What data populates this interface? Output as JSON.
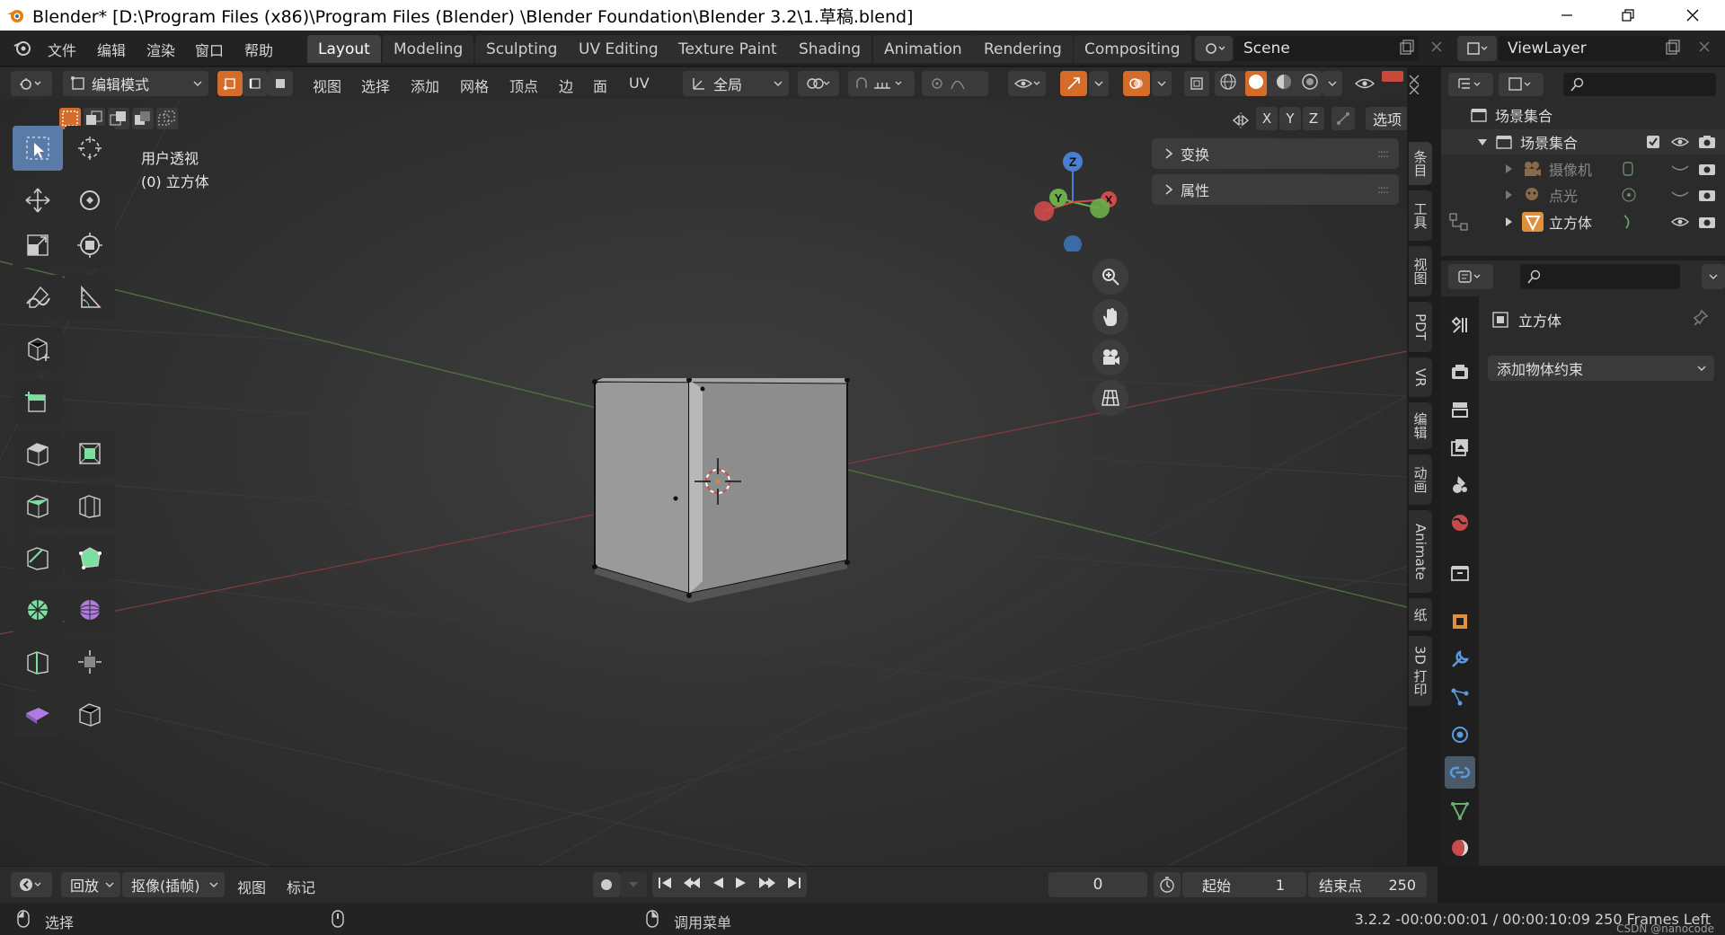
{
  "titlebar": {
    "title": "Blender* [D:\\Program Files (x86)\\Program Files  (Blender)  \\Blender Foundation\\Blender 3.2\\1.草稿.blend]"
  },
  "menu": {
    "file": "文件",
    "edit": "编辑",
    "render": "渲染",
    "window": "窗口",
    "help": "帮助"
  },
  "workspaces": [
    {
      "label": "Layout",
      "active": true
    },
    {
      "label": "Modeling"
    },
    {
      "label": "Sculpting"
    },
    {
      "label": "UV Editing"
    },
    {
      "label": "Texture Paint"
    },
    {
      "label": "Shading"
    },
    {
      "label": "Animation"
    },
    {
      "label": "Rendering"
    },
    {
      "label": "Compositing"
    }
  ],
  "scene": {
    "name": "Scene",
    "view_layer": "ViewLayer"
  },
  "header": {
    "mode": "编辑模式",
    "view": "视图",
    "select": "选择",
    "add": "添加",
    "mesh": "网格",
    "vertex": "顶点",
    "edge": "边",
    "face": "面",
    "uv": "UV",
    "orientation": "全局",
    "options": "选项",
    "axis_x": "X",
    "axis_y": "Y",
    "axis_z": "Z"
  },
  "viewport": {
    "perspective": "用户透视",
    "object_label": "(0) 立方体"
  },
  "gizmo": {
    "z": "Z",
    "y": "Y",
    "x": "X"
  },
  "n_panel": {
    "transform": "变换",
    "properties": "属性"
  },
  "side_tabs": [
    "条目",
    "工具",
    "视图",
    "PDT",
    "VR",
    "编辑",
    "动画",
    "Animate",
    "纸",
    "3D 打印"
  ],
  "outliner": {
    "scene_collection": "场景集合",
    "collection": "场景集合",
    "items": [
      {
        "name": "摄像机"
      },
      {
        "name": "点光"
      },
      {
        "name": "立方体"
      }
    ]
  },
  "properties": {
    "object_name": "立方体",
    "add_constraint": "添加物体约束"
  },
  "timeline": {
    "playback": "回放",
    "keying": "抠像(插帧)",
    "view": "视图",
    "marker": "标记",
    "current_frame": "0",
    "start_label": "起始",
    "start": "1",
    "end_label": "结束点",
    "end": "250"
  },
  "status": {
    "select": "选择",
    "context_menu": "调用菜单",
    "info": "3.2.2 -00:00:00:01 / 00:00:10:09  250 Frames Left",
    "watermark": "CSDN @nanocode"
  },
  "colors": {
    "accent": "#5a7ba8",
    "axis_x": "#d04a4a",
    "axis_y": "#6aae4a",
    "axis_z": "#4a7ed0",
    "active_tool": "#5a7ba8"
  }
}
